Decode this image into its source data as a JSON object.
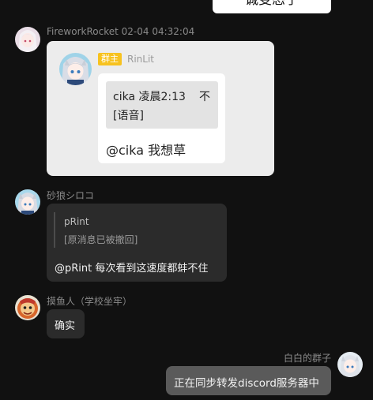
{
  "top_message": {
    "text": "诚变态了"
  },
  "messages": [
    {
      "sender": "FireworkRocket",
      "time": "02-04 04:32:04",
      "forwarded": {
        "badge": "群主",
        "name": "RinLit",
        "quote_line1": "cika 凌晨2:13",
        "quote_line1_tail": "不",
        "quote_line2": "[语音]",
        "text": "@cika 我想草"
      }
    },
    {
      "sender": "砂狼シロコ",
      "reply": {
        "name": "pRint",
        "text": "[原消息已被撤回]"
      },
      "text": "@pRint 每次看到这速度都蚌不住"
    },
    {
      "sender": "摸鱼人（学校坐牢）",
      "text": "确实"
    },
    {
      "sender": "白白的群子",
      "text": "正在同步转发discord服务器中"
    }
  ],
  "colors": {
    "background": "#111111",
    "dark_bubble": "#2b2b2b",
    "self_bubble": "#5a5a5a",
    "badge": "#f7c21f"
  },
  "icons": [
    "avatar-anime-white",
    "avatar-anime-blue",
    "avatar-lion"
  ]
}
